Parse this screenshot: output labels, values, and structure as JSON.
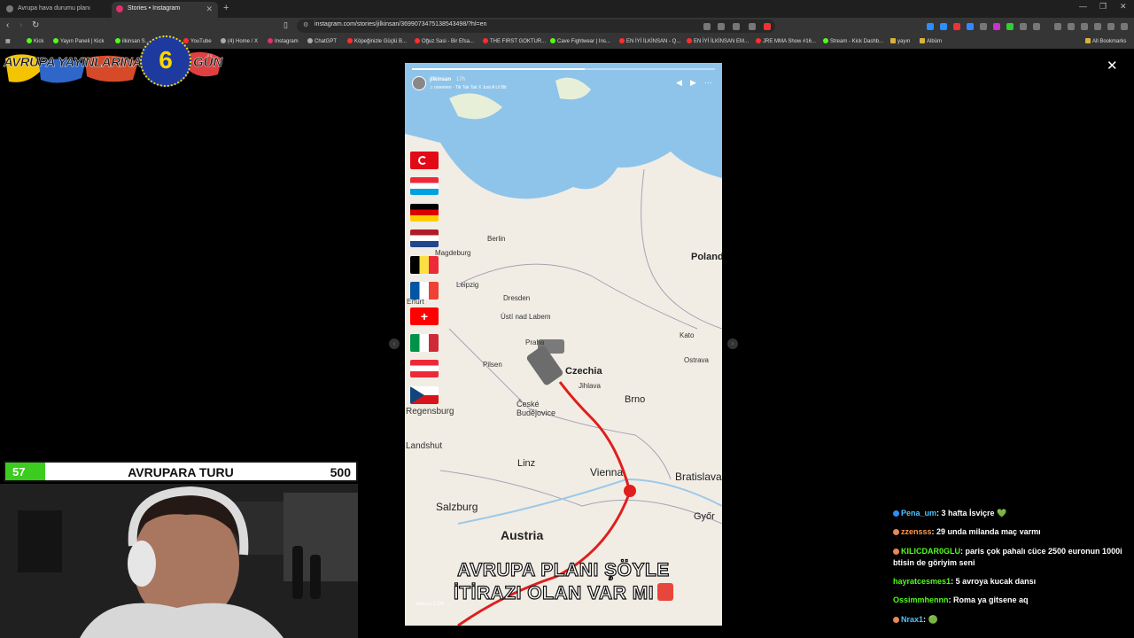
{
  "browser": {
    "tabs": [
      {
        "title": "Avrupa hava durumu planı",
        "active": false
      },
      {
        "title": "Stories • Instagram",
        "active": true
      }
    ],
    "url": "instagram.com/stories/jilkinsan/3699073475138543498/?hl=en",
    "bookmarks": [
      {
        "label": "Kick",
        "icon": "kick"
      },
      {
        "label": "Yayın Paneli | Kick",
        "icon": "kick"
      },
      {
        "label": "ilkinsan S...",
        "icon": "kick"
      },
      {
        "label": "YouTube",
        "icon": "youtube"
      },
      {
        "label": "(4) Home / X",
        "icon": "x"
      },
      {
        "label": "Instagram",
        "icon": "instagram"
      },
      {
        "label": "ChatGPT",
        "icon": "chatgpt"
      },
      {
        "label": "Köpeğinizle Güçlü B...",
        "icon": "youtube"
      },
      {
        "label": "Oğuz Sasi - Bir Efsa...",
        "icon": "youtube"
      },
      {
        "label": "THE FIRST GOKTUR...",
        "icon": "youtube"
      },
      {
        "label": "Cave Fightwear | Ins...",
        "icon": "web"
      },
      {
        "label": "EN İYİ İLKİNSAN - Q...",
        "icon": "youtube"
      },
      {
        "label": "EN İYİ İLKİNSAN EM...",
        "icon": "youtube"
      },
      {
        "label": "JRE MMA Show #16...",
        "icon": "youtube"
      },
      {
        "label": "Stream - Kick Dashb...",
        "icon": "kick"
      },
      {
        "label": "yayın",
        "icon": "folder"
      },
      {
        "label": "Albüm",
        "icon": "folder"
      }
    ],
    "all_bookmarks": "All Bookmarks"
  },
  "overlay_logo": {
    "text_left": "AVRUPA YAYINLARINA",
    "number": "6",
    "text_right": "GÜN"
  },
  "story": {
    "username": "jilkinsan",
    "time": "17h",
    "music": "♫ ravemen · Tik Tak Tak X Just A Lil Bit",
    "progress": 0.57,
    "map_labels": {
      "countries": [
        "Poland",
        "Czechia",
        "Austria"
      ],
      "cities": [
        "Berlin",
        "Magdeburg",
        "Leipzig",
        "Dresden",
        "Erfurt",
        "Ústí nad Labem",
        "Pilsen",
        "Praha",
        "Jihlava",
        "Brno",
        "České Budějovice",
        "Regensburg",
        "Landshut",
        "Linz",
        "Vienna",
        "Bratislava",
        "Salzburg",
        "Győr",
        "Ostrava",
        "Kato"
      ]
    },
    "flags": [
      "Turkey",
      "Luxembourg",
      "Germany",
      "Netherlands",
      "Belgium",
      "France",
      "Switzerland",
      "Italy",
      "Austria",
      "Czechia"
    ],
    "caption_line1": "AVRUPA PLANI ŞÖYLE",
    "caption_line2": "İTİRAZI OLAN VAR MI",
    "footer": "Seen by 2,156",
    "route_color": "#e01e1e"
  },
  "scoreboard": {
    "left": "57",
    "title": "AVRUPARA TURU",
    "right": "500",
    "progress": 0.114,
    "fill_color": "#3ccb1f"
  },
  "chat": {
    "messages": [
      {
        "user": "Pena_um",
        "text": "3 hafta İsviçre 💚",
        "color": "#4fc3ff",
        "badge": "blue"
      },
      {
        "user": "zzensss",
        "text": "29 unda milanda maç varmı",
        "color": "#ff9b52",
        "badge": "orange"
      },
      {
        "user": "KILICDAR0GLU",
        "text": "paris çok pahalı cüce 2500 euronun 1000i btisin de göriyim seni",
        "color": "#53fc18",
        "badge": "orange"
      },
      {
        "user": "hayratcesmes1",
        "text": "5 avroya kucak dansı",
        "color": "#53fc18",
        "badge": "none"
      },
      {
        "user": "Ossimmhennn",
        "text": "Roma ya gitsene aq",
        "color": "#53fc18",
        "badge": "none"
      },
      {
        "user": "Nrax1",
        "text": "🟢",
        "color": "#4fc3ff",
        "badge": "orange"
      }
    ]
  }
}
